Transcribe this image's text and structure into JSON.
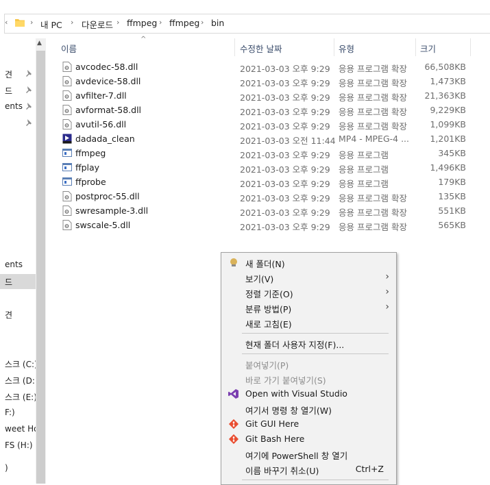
{
  "address": {
    "segments": [
      "내 PC",
      "다운로드",
      "ffmpeg",
      "ffmpeg",
      "bin"
    ]
  },
  "nav": {
    "items": [
      "견",
      "드",
      "ents",
      "",
      "ents",
      "드",
      "견",
      "스크 (C:)",
      "스크 (D:)",
      "스크 (E:)",
      "F:)",
      "weet Ho",
      "FS (H:)",
      ")"
    ]
  },
  "columns": {
    "name": "이름",
    "date": "수정한 날짜",
    "type": "유형",
    "size": "크기"
  },
  "files": [
    {
      "name": "avcodec-58.dll",
      "date": "2021-03-03 오후 9:29",
      "type": "응용 프로그램 확장",
      "size": "66,508KB",
      "icon": "dll-icon"
    },
    {
      "name": "avdevice-58.dll",
      "date": "2021-03-03 오후 9:29",
      "type": "응용 프로그램 확장",
      "size": "1,473KB",
      "icon": "dll-icon"
    },
    {
      "name": "avfilter-7.dll",
      "date": "2021-03-03 오후 9:29",
      "type": "응용 프로그램 확장",
      "size": "21,363KB",
      "icon": "dll-icon"
    },
    {
      "name": "avformat-58.dll",
      "date": "2021-03-03 오후 9:29",
      "type": "응용 프로그램 확장",
      "size": "9,229KB",
      "icon": "dll-icon"
    },
    {
      "name": "avutil-56.dll",
      "date": "2021-03-03 오후 9:29",
      "type": "응용 프로그램 확장",
      "size": "1,099KB",
      "icon": "dll-icon"
    },
    {
      "name": "dadada_clean",
      "date": "2021-03-03 오전 11:44",
      "type": "MP4 - MPEG-4 ...",
      "size": "1,201KB",
      "icon": "mp4-icon"
    },
    {
      "name": "ffmpeg",
      "date": "2021-03-03 오후 9:29",
      "type": "응용 프로그램",
      "size": "345KB",
      "icon": "exe-icon"
    },
    {
      "name": "ffplay",
      "date": "2021-03-03 오후 9:29",
      "type": "응용 프로그램",
      "size": "1,496KB",
      "icon": "exe-icon"
    },
    {
      "name": "ffprobe",
      "date": "2021-03-03 오후 9:29",
      "type": "응용 프로그램",
      "size": "179KB",
      "icon": "exe-icon"
    },
    {
      "name": "postproc-55.dll",
      "date": "2021-03-03 오후 9:29",
      "type": "응용 프로그램 확장",
      "size": "135KB",
      "icon": "dll-icon"
    },
    {
      "name": "swresample-3.dll",
      "date": "2021-03-03 오후 9:29",
      "type": "응용 프로그램 확장",
      "size": "551KB",
      "icon": "dll-icon"
    },
    {
      "name": "swscale-5.dll",
      "date": "2021-03-03 오후 9:29",
      "type": "응용 프로그램 확장",
      "size": "565KB",
      "icon": "dll-icon"
    }
  ],
  "context_menu": {
    "new_folder": "새 폴더(N)",
    "view": "보기(V)",
    "sort_by": "정렬 기준(O)",
    "group_by": "분류 방법(P)",
    "refresh": "새로 고침(E)",
    "customize": "현재 폴더 사용자 지정(F)...",
    "paste": "붙여넣기(P)",
    "paste_shortcut": "바로 가기 붙여넣기(S)",
    "open_vs": "Open with Visual Studio",
    "open_cmd": "여기서 명령 창 열기(W)",
    "git_gui": "Git GUI Here",
    "git_bash": "Git Bash Here",
    "open_ps": "여기에 PowerShell 창 열기",
    "undo_rename": "이름 바꾸기 취소(U)",
    "undo_shortcut": "Ctrl+Z"
  },
  "colors": {
    "menu_bg": "#f2f2f2",
    "header_text": "#3a4c6b",
    "vs_purple": "#7b3fb0",
    "git_orange": "#e94e31"
  }
}
